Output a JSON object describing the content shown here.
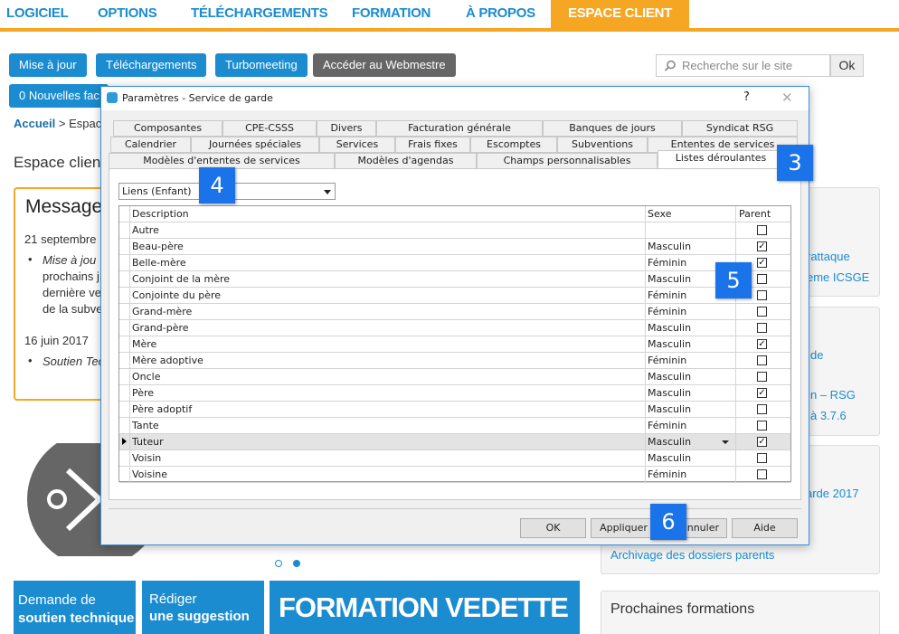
{
  "nav": {
    "items": [
      "LOGICIEL",
      "OPTIONS",
      "TÉLÉCHARGEMENTS",
      "FORMATION",
      "À PROPOS",
      "ESPACE CLIENT"
    ]
  },
  "toolbar": {
    "buttons": [
      "Mise à jour",
      "Téléchargements",
      "Turbomeeting",
      "Accéder au Webmestre"
    ],
    "second_row": "0 Nouvelles fac"
  },
  "search": {
    "placeholder": "Recherche sur le site",
    "ok": "Ok"
  },
  "breadcrumb": {
    "home": "Accueil",
    "rest": " > Espac"
  },
  "page": {
    "espace": "Espace clien",
    "message_title": "Message",
    "date1": "21 septembre",
    "bullet1_lines": [
      "Mise à jou",
      "prochains j",
      "dernière ve",
      "de la subve"
    ],
    "date2": "16 juin 2017",
    "bullet2": "Soutien Tec"
  },
  "right": {
    "links": [
      "rattaque",
      "eme ICSGE",
      "de",
      "n – RSG",
      "à 3.7.6",
      "arde 2017",
      "Archivage des dossiers parents"
    ],
    "prochaines": "Prochaines formations"
  },
  "tiles": {
    "t1a": "Demande de",
    "t1b": "soutien technique",
    "t2a": "Rédiger",
    "t2b": "une suggestion",
    "t3": "FORMATION VEDETTE"
  },
  "dialog": {
    "title": "Paramètres - Service de garde",
    "help": "?",
    "close": "✕",
    "tabs_row1": [
      "Composantes",
      "CPE-CSSS",
      "Divers",
      "Facturation générale",
      "Banques de jours",
      "Syndicat RSG"
    ],
    "tabs_row2": [
      "Calendrier",
      "Journées spéciales",
      "Services",
      "Frais fixes",
      "Escomptes",
      "Subventions",
      "Ententes de services"
    ],
    "tabs_row3": [
      "Modèles d'ententes de services",
      "Modèles d'agendas",
      "Champs personnalisables",
      "Listes déroulantes"
    ],
    "combo_value": "Liens (Enfant)",
    "columns": [
      "Description",
      "Sexe",
      "Parent"
    ],
    "rows": [
      {
        "desc": "Autre",
        "sexe": "",
        "parent": false
      },
      {
        "desc": "Beau-père",
        "sexe": "Masculin",
        "parent": true
      },
      {
        "desc": "Belle-mère",
        "sexe": "Féminin",
        "parent": true
      },
      {
        "desc": "Conjoint de la mère",
        "sexe": "Masculin",
        "parent": false
      },
      {
        "desc": "Conjointe du père",
        "sexe": "Féminin",
        "parent": false
      },
      {
        "desc": "Grand-mère",
        "sexe": "Féminin",
        "parent": false
      },
      {
        "desc": "Grand-père",
        "sexe": "Masculin",
        "parent": false
      },
      {
        "desc": "Mère",
        "sexe": "Masculin",
        "parent": true
      },
      {
        "desc": "Mère adoptive",
        "sexe": "Féminin",
        "parent": false
      },
      {
        "desc": "Oncle",
        "sexe": "Masculin",
        "parent": false
      },
      {
        "desc": "Père",
        "sexe": "Masculin",
        "parent": true
      },
      {
        "desc": "Père adoptif",
        "sexe": "Masculin",
        "parent": false
      },
      {
        "desc": "Tante",
        "sexe": "Féminin",
        "parent": false
      },
      {
        "desc": "Tuteur",
        "sexe": "Masculin",
        "parent": true
      },
      {
        "desc": "Voisin",
        "sexe": "Masculin",
        "parent": false
      },
      {
        "desc": "Voisine",
        "sexe": "Féminin",
        "parent": false
      }
    ],
    "buttons": [
      "OK",
      "Appliquer",
      "nnuler",
      "Aide"
    ]
  },
  "badges": [
    "3",
    "4",
    "5",
    "6"
  ],
  "colors": {
    "accent": "#f5a623",
    "brand": "#1a8ccf",
    "badge": "#1a73e8"
  }
}
